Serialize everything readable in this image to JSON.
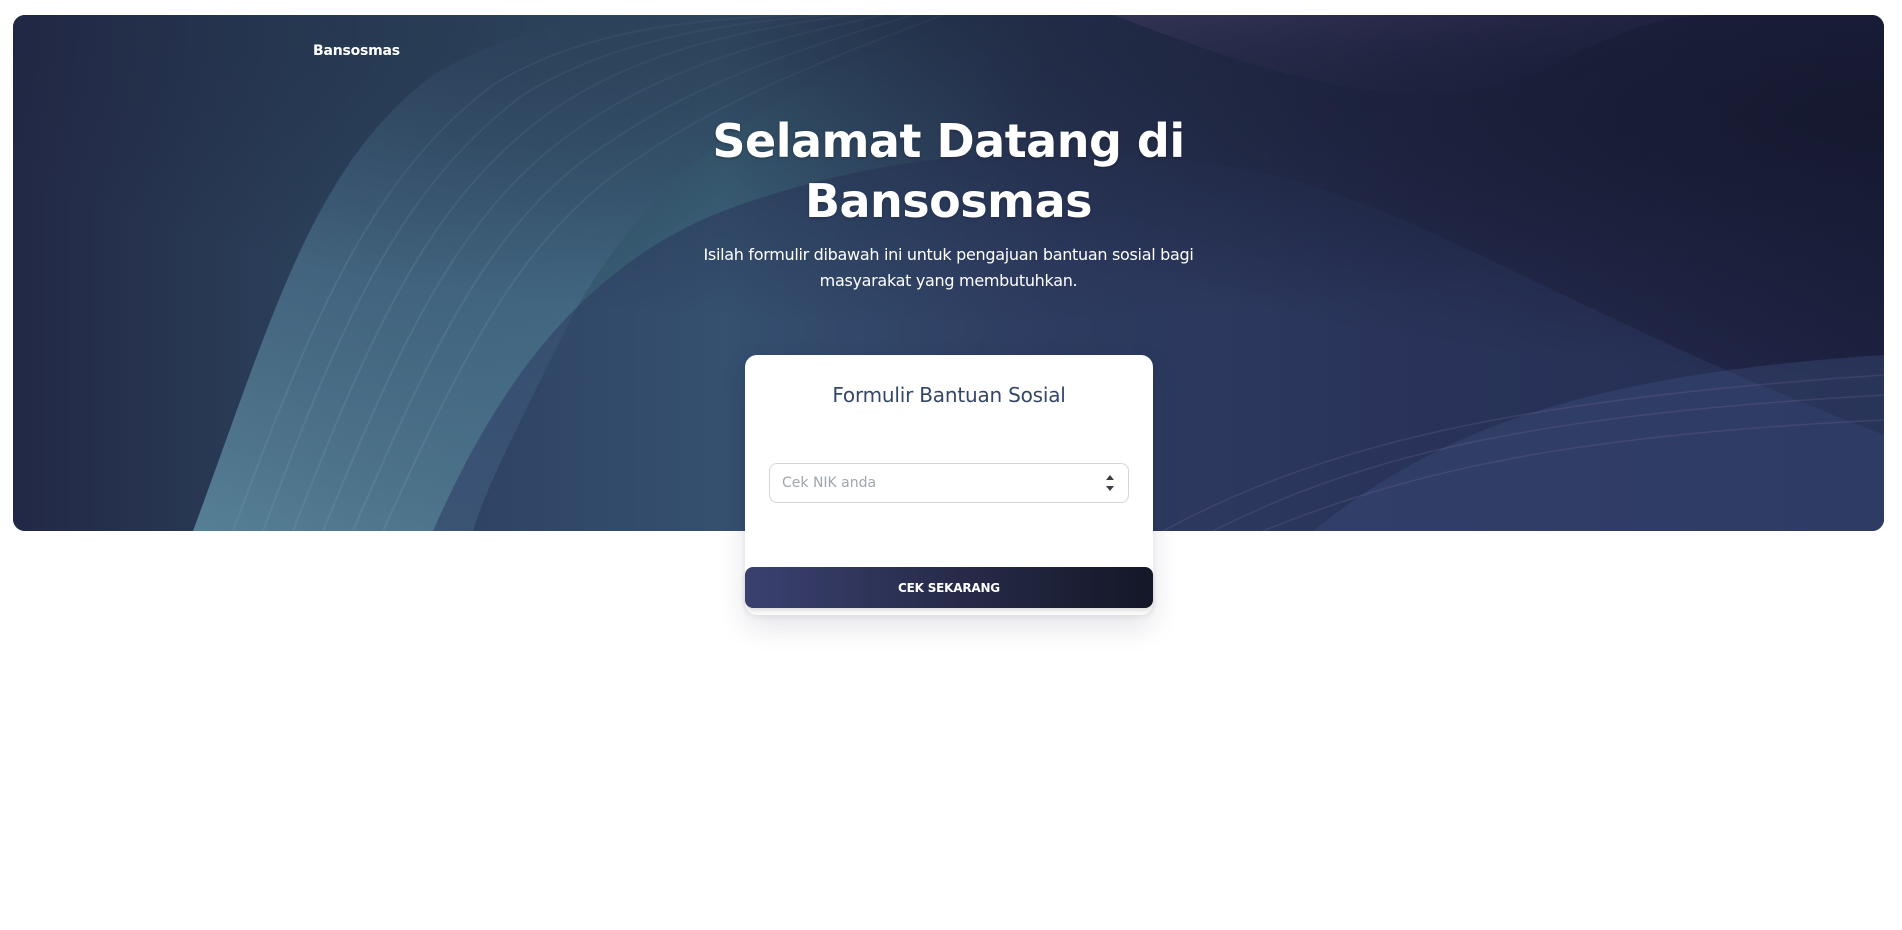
{
  "navbar": {
    "brand": "Bansosmas"
  },
  "hero": {
    "title_line1": "Selamat Datang di",
    "title_line2": "Bansosmas",
    "subtitle_line1": "Isilah formulir dibawah ini untuk pengajuan bantuan sosial bagi",
    "subtitle_line2": "masyarakat yang membutuhkan."
  },
  "form": {
    "title": "Formulir Bantuan Sosial",
    "nik_placeholder": "Cek NIK anda",
    "nik_value": "",
    "submit_label": "CEK SEKARANG"
  },
  "colors": {
    "hero_base": "#1f2440",
    "button_gradient_start": "#3a416f",
    "button_gradient_end": "#141727",
    "card_title": "#344767"
  },
  "icons": {
    "number_spinner": "spinner-arrows-icon"
  }
}
